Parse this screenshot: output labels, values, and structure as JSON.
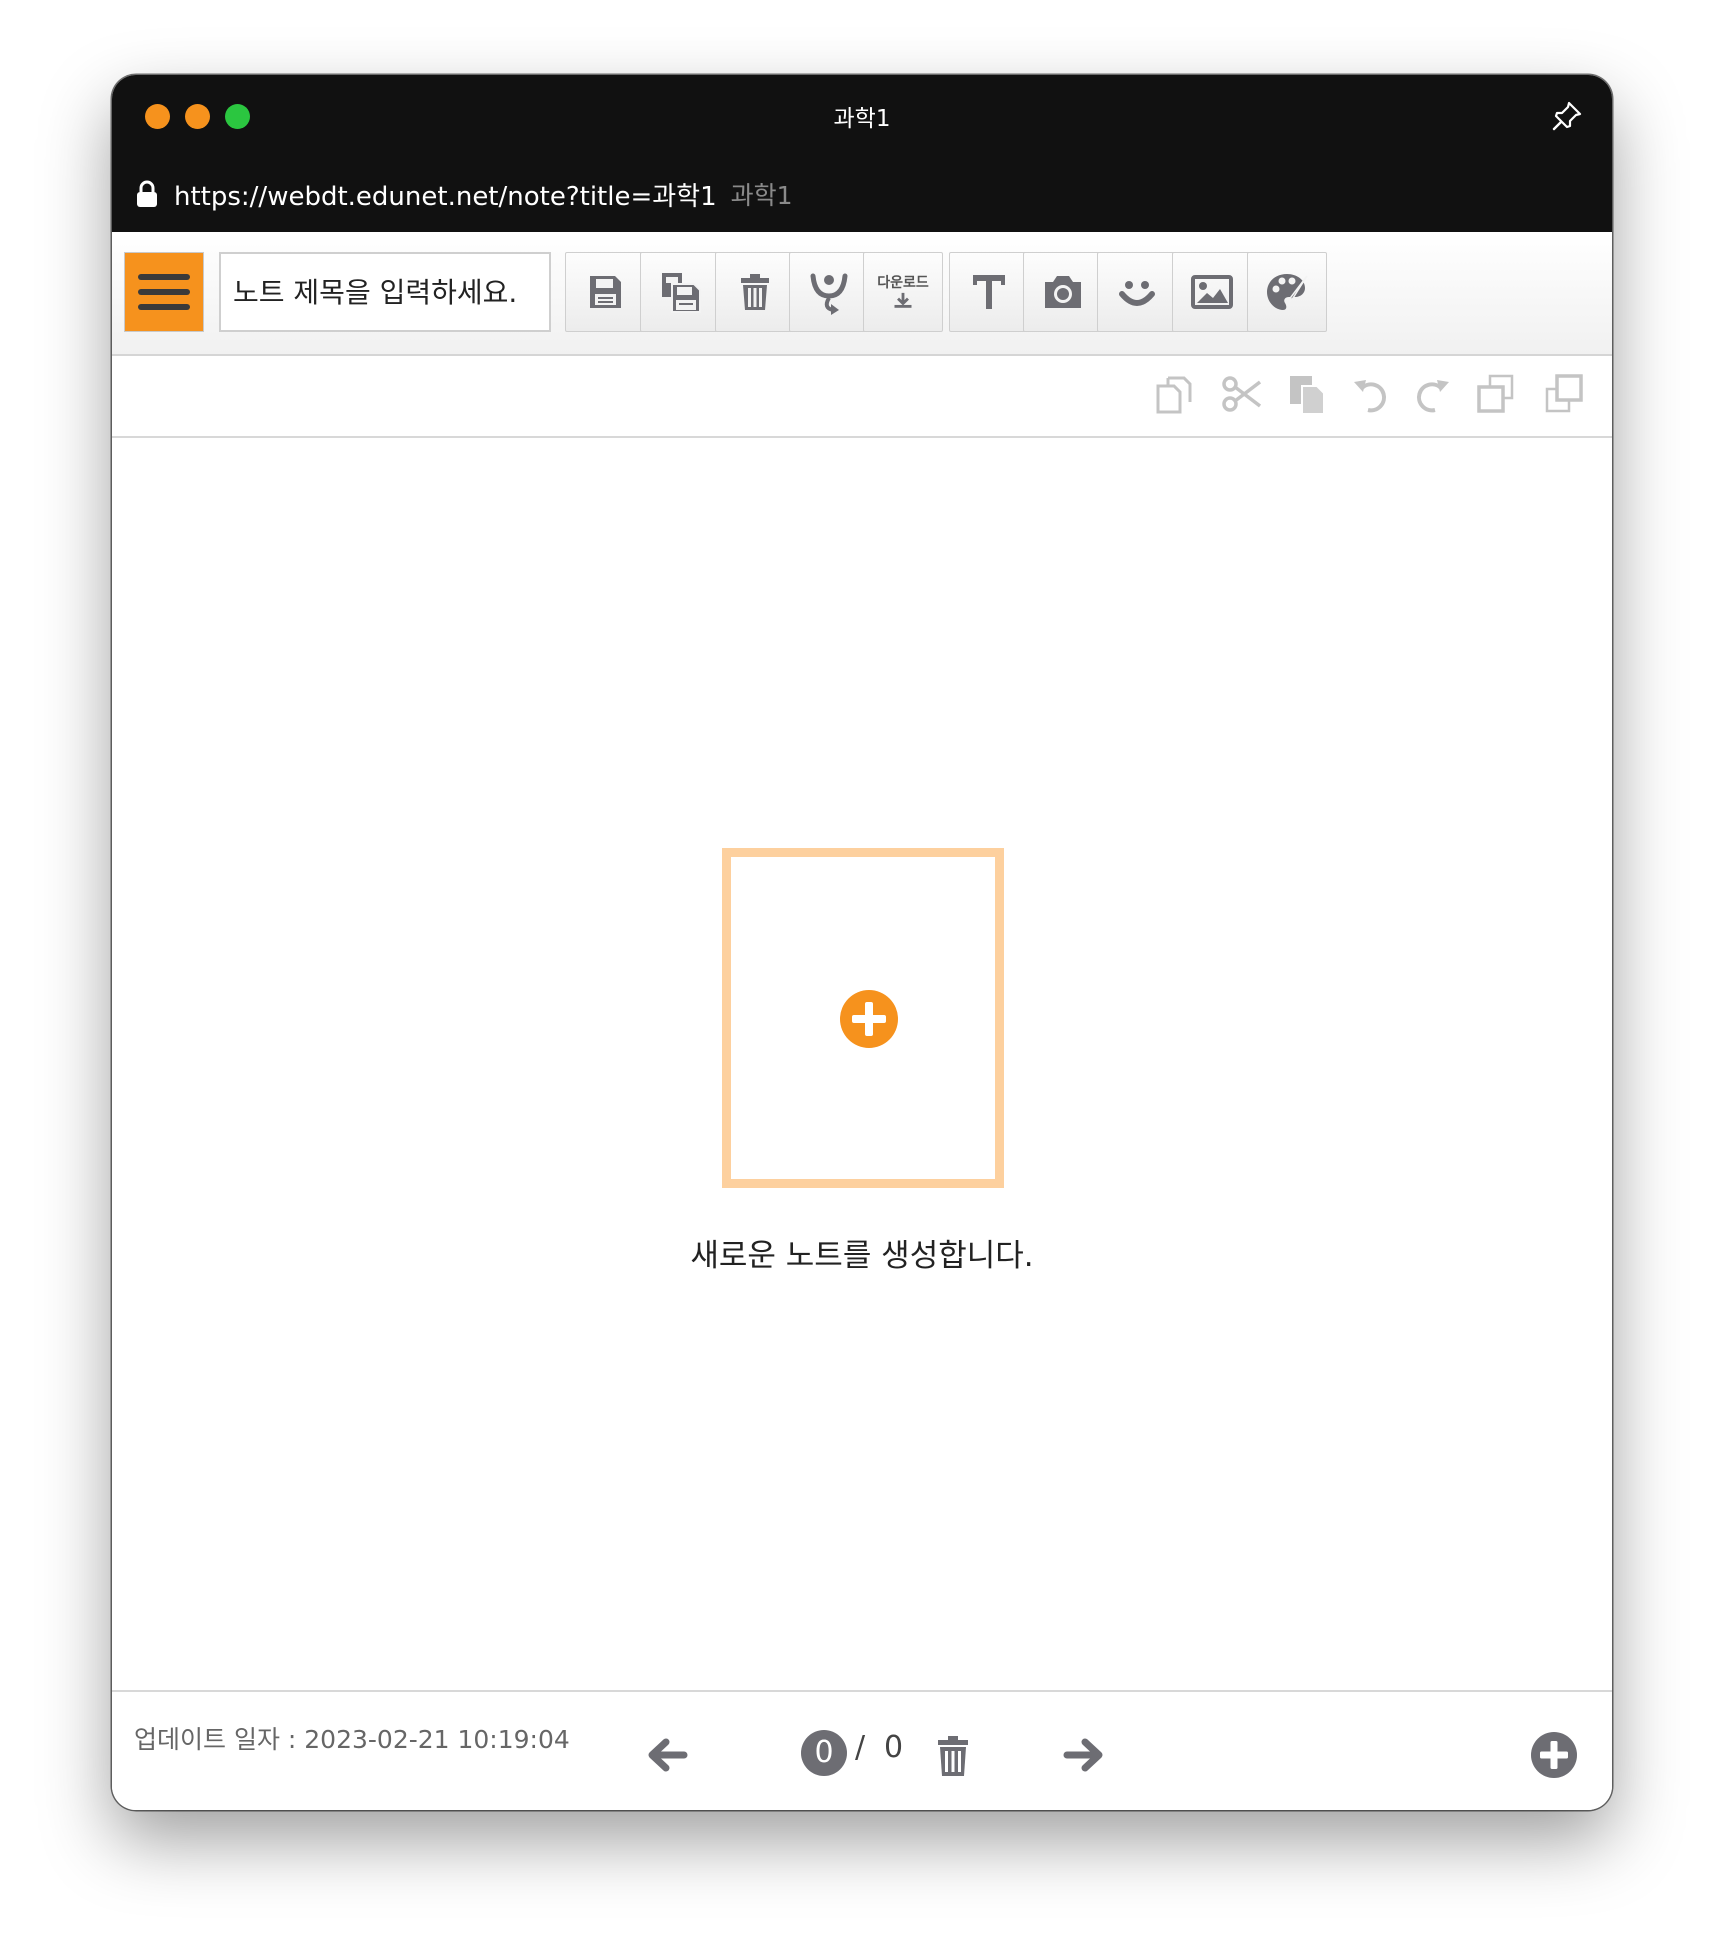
{
  "window": {
    "title": "과학1",
    "url": "https://webdt.edunet.net/note?title=과학1",
    "url_page_title": "과학1"
  },
  "toolbar": {
    "title_placeholder": "노트 제목을 입력하세요.",
    "download_label": "다운로드",
    "buttons": [
      "menu-icon",
      "save-icon",
      "copy-note-icon",
      "trash-icon",
      "share-icon",
      "download-icon",
      "text-icon",
      "camera-icon",
      "smile-icon",
      "image-icon",
      "palette-icon"
    ]
  },
  "edit_bar": {
    "icons": [
      "duplicate-icon",
      "cut-icon",
      "paste-icon",
      "undo-icon",
      "redo-icon",
      "bring-front-icon",
      "send-back-icon"
    ]
  },
  "canvas": {
    "new_note_caption": "새로운 노트를 생성합니다."
  },
  "footer": {
    "updated_text": "업데이트 일자 : 2023-02-21 10:19:04",
    "page_current": "0",
    "page_separator": "/",
    "page_total": "0"
  },
  "colors": {
    "accent": "#f6921d",
    "card_border": "#fdd09e",
    "icon_gray": "#6d6d73",
    "titlebar": "#111111"
  }
}
